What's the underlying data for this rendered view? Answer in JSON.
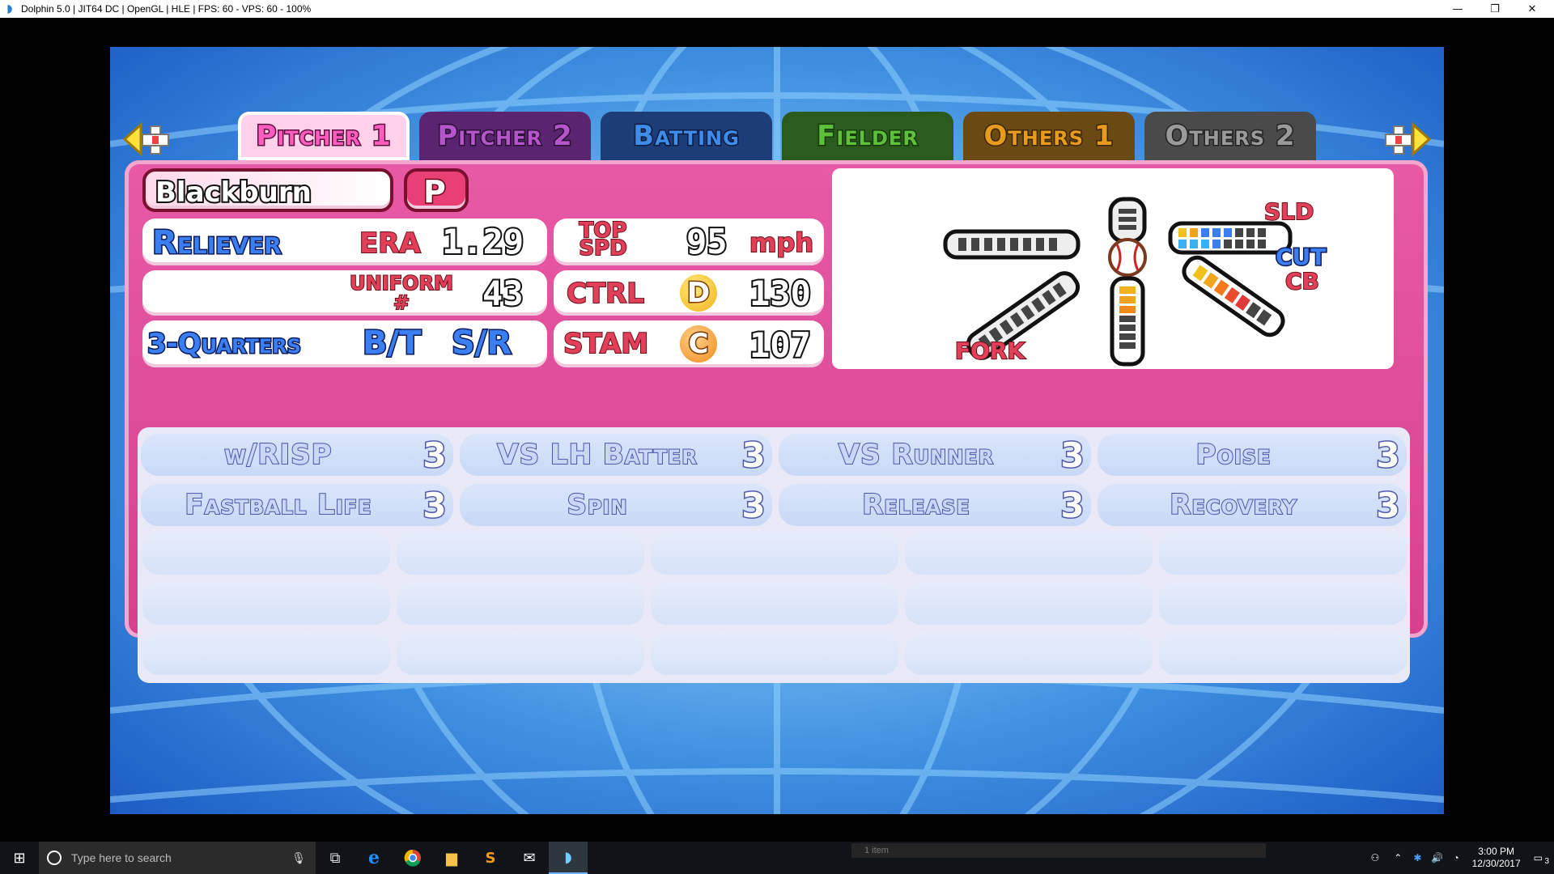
{
  "window": {
    "title": "Dolphin 5.0 | JIT64 DC | OpenGL | HLE | FPS: 60 - VPS: 60 - 100%",
    "minimize": "—",
    "restore": "❐",
    "close": "✕"
  },
  "tabs": [
    {
      "label": "Pitcher 1",
      "color": "#ff5cc0",
      "active": true
    },
    {
      "label": "Pitcher 2",
      "color": "#b455c9",
      "active": false
    },
    {
      "label": "Batting",
      "color": "#3f8be8",
      "active": false
    },
    {
      "label": "Fielder",
      "color": "#5fbf3a",
      "active": false
    },
    {
      "label": "Others 1",
      "color": "#e69a1e",
      "active": false
    },
    {
      "label": "Others 2",
      "color": "#9a9a9a",
      "active": false
    }
  ],
  "player": {
    "name": "Blackburn",
    "position": "P",
    "role": "Reliever",
    "era_label": "ERA",
    "era": "1.29",
    "top_spd_label": "TOP SPD",
    "top_spd": "95",
    "unit": "mph",
    "uniform_label": "UNIFORM #",
    "uniform": "43",
    "ctrl_label": "CTRL",
    "ctrl_grade": "D",
    "ctrl": "130",
    "delivery": "3-Quarters",
    "bt": "B/T",
    "hand": "S/R",
    "stam_label": "STAM",
    "stam_grade": "C",
    "stam": "107"
  },
  "pitches": {
    "sld": "SLD",
    "cut": "CUT",
    "cb": "CB",
    "fork": "FORK",
    "slider_level": 7,
    "curve_level": 5,
    "fork_level": 0,
    "sinker_level": 0,
    "fastball_level": 6
  },
  "abilities": [
    {
      "label": "w/RISP",
      "level": "3"
    },
    {
      "label": "VS LH Batter",
      "level": "3"
    },
    {
      "label": "VS Runner",
      "level": "3"
    },
    {
      "label": "Poise",
      "level": "3"
    },
    {
      "label": "Fastball Life",
      "level": "3"
    },
    {
      "label": "Spin",
      "level": "3"
    },
    {
      "label": "Release",
      "level": "3"
    },
    {
      "label": "Recovery",
      "level": "3"
    }
  ],
  "taskbar": {
    "search_placeholder": "Type here to search",
    "items_text": "1 item",
    "time": "3:00 PM",
    "date": "12/30/2017",
    "notif_count": "3"
  },
  "colors": {
    "panel": "#e04d9b",
    "sky": "#3f8fe0",
    "grade_d": "#f2b21c",
    "grade_c": "#f08a1c"
  }
}
